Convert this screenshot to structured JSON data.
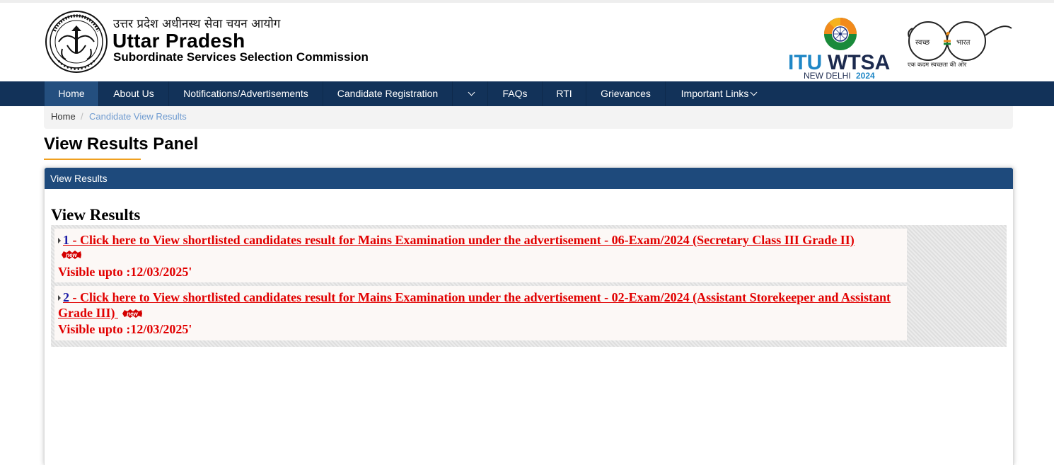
{
  "header": {
    "hindi_title": "उत्तर प्रदेश अधीनस्थ सेवा चयन आयोग",
    "title": "Uttar Pradesh",
    "subtitle": "Subordinate Services Selection Commission",
    "itu_logo": {
      "brand_part1": "ITU",
      "brand_part2": "WTSA",
      "city": "NEW DELHI",
      "year": "2024"
    },
    "swachh_logo": {
      "word1": "स्वच्छ",
      "word2": "भारत",
      "tagline": "एक कदम स्वच्छता की ओर"
    }
  },
  "nav": {
    "items": [
      "Home",
      "About Us",
      "Notifications/Advertisements",
      "Candidate Registration",
      "",
      "FAQs",
      "RTI",
      "Grievances",
      "Important Links"
    ]
  },
  "breadcrumb": {
    "home": "Home",
    "separator": "/",
    "current": "Candidate View Results"
  },
  "page_title": "View Results Panel",
  "panel": {
    "header": "View Results",
    "heading": "View Results",
    "results": [
      {
        "number": "1",
        "text": " - Click here to View shortlisted candidates result for Mains Examination under the advertisement - 06-Exam/2024 (Secretary Class III Grade II)",
        "badge": "new",
        "visible_upto": "Visible upto :12/03/2025'"
      },
      {
        "number": "2",
        "text": " - Click here to View shortlisted candidates result for Mains Examination under the advertisement - 02-Exam/2024 (Assistant Storekeeper and Assistant Grade III) ",
        "badge": "new",
        "visible_upto": "Visible upto :12/03/2025'"
      }
    ]
  },
  "colors": {
    "nav_bg": "#123259",
    "nav_active": "#244f7f",
    "panel_header": "#1e4a7c",
    "result_text": "#e10000",
    "title_underline": "#f0a020"
  }
}
